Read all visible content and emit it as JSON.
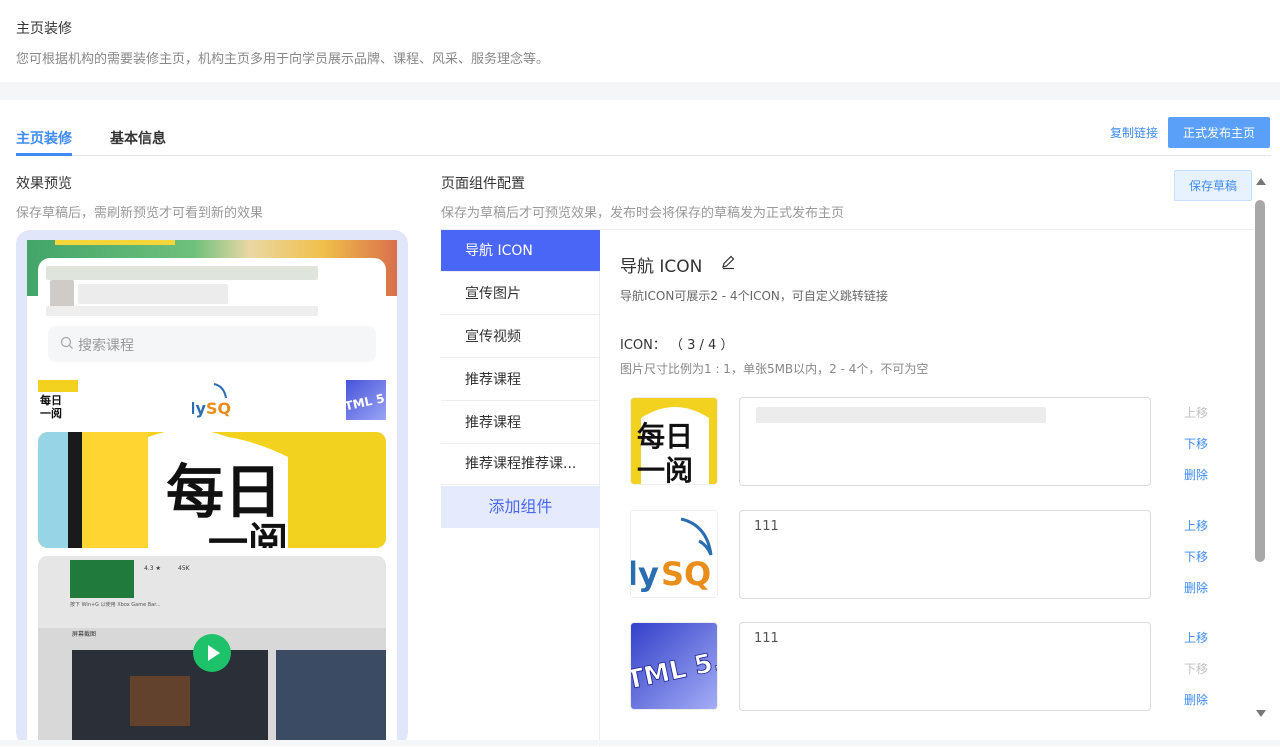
{
  "header": {
    "title": "主页装修",
    "description": "您可根据机构的需要装修主页，机构主页多用于向学员展示品牌、课程、风采、服务理念等。"
  },
  "tabs": [
    {
      "label": "主页装修",
      "active": true
    },
    {
      "label": "基本信息",
      "active": false
    }
  ],
  "toolbar": {
    "copy_link": "复制链接",
    "publish": "正式发布主页",
    "save_draft": "保存草稿"
  },
  "preview": {
    "title": "效果预览",
    "desc": "保存草稿后，需刷新预览才可看到新的效果",
    "search_placeholder": "搜索课程"
  },
  "config": {
    "title": "页面组件配置",
    "desc": "保存为草稿后才可预览效果，发布时会将保存的草稿发为正式发布主页",
    "menu": [
      {
        "label": "导航 ICON",
        "active": true
      },
      {
        "label": "宣传图片",
        "active": false
      },
      {
        "label": "宣传视频",
        "active": false
      },
      {
        "label": "推荐课程",
        "active": false
      },
      {
        "label": "推荐课程",
        "active": false
      },
      {
        "label": "推荐课程推荐课...",
        "active": false
      }
    ],
    "add_component": "添加组件"
  },
  "panel": {
    "title": "导航 ICON",
    "desc": "导航ICON可展示2 - 4个ICON，可自定义跳转链接",
    "icon_label": "ICON： （ 3 / 4 ）",
    "icon_hint": "图片尺寸比例为1 : 1，单张5MB以内，2 - 4个，不可为空",
    "items": [
      {
        "value": "",
        "move_up": "上移",
        "move_down": "下移",
        "delete": "删除",
        "up_enabled": false,
        "down_enabled": true
      },
      {
        "value": "111",
        "move_up": "上移",
        "move_down": "下移",
        "delete": "删除",
        "up_enabled": true,
        "down_enabled": true
      },
      {
        "value": "111",
        "move_up": "上移",
        "move_down": "下移",
        "delete": "删除",
        "up_enabled": true,
        "down_enabled": false
      }
    ]
  },
  "colors": {
    "accent": "#3e8bf6",
    "menu_active": "#4a66f6",
    "play_button": "#1ec26b"
  }
}
